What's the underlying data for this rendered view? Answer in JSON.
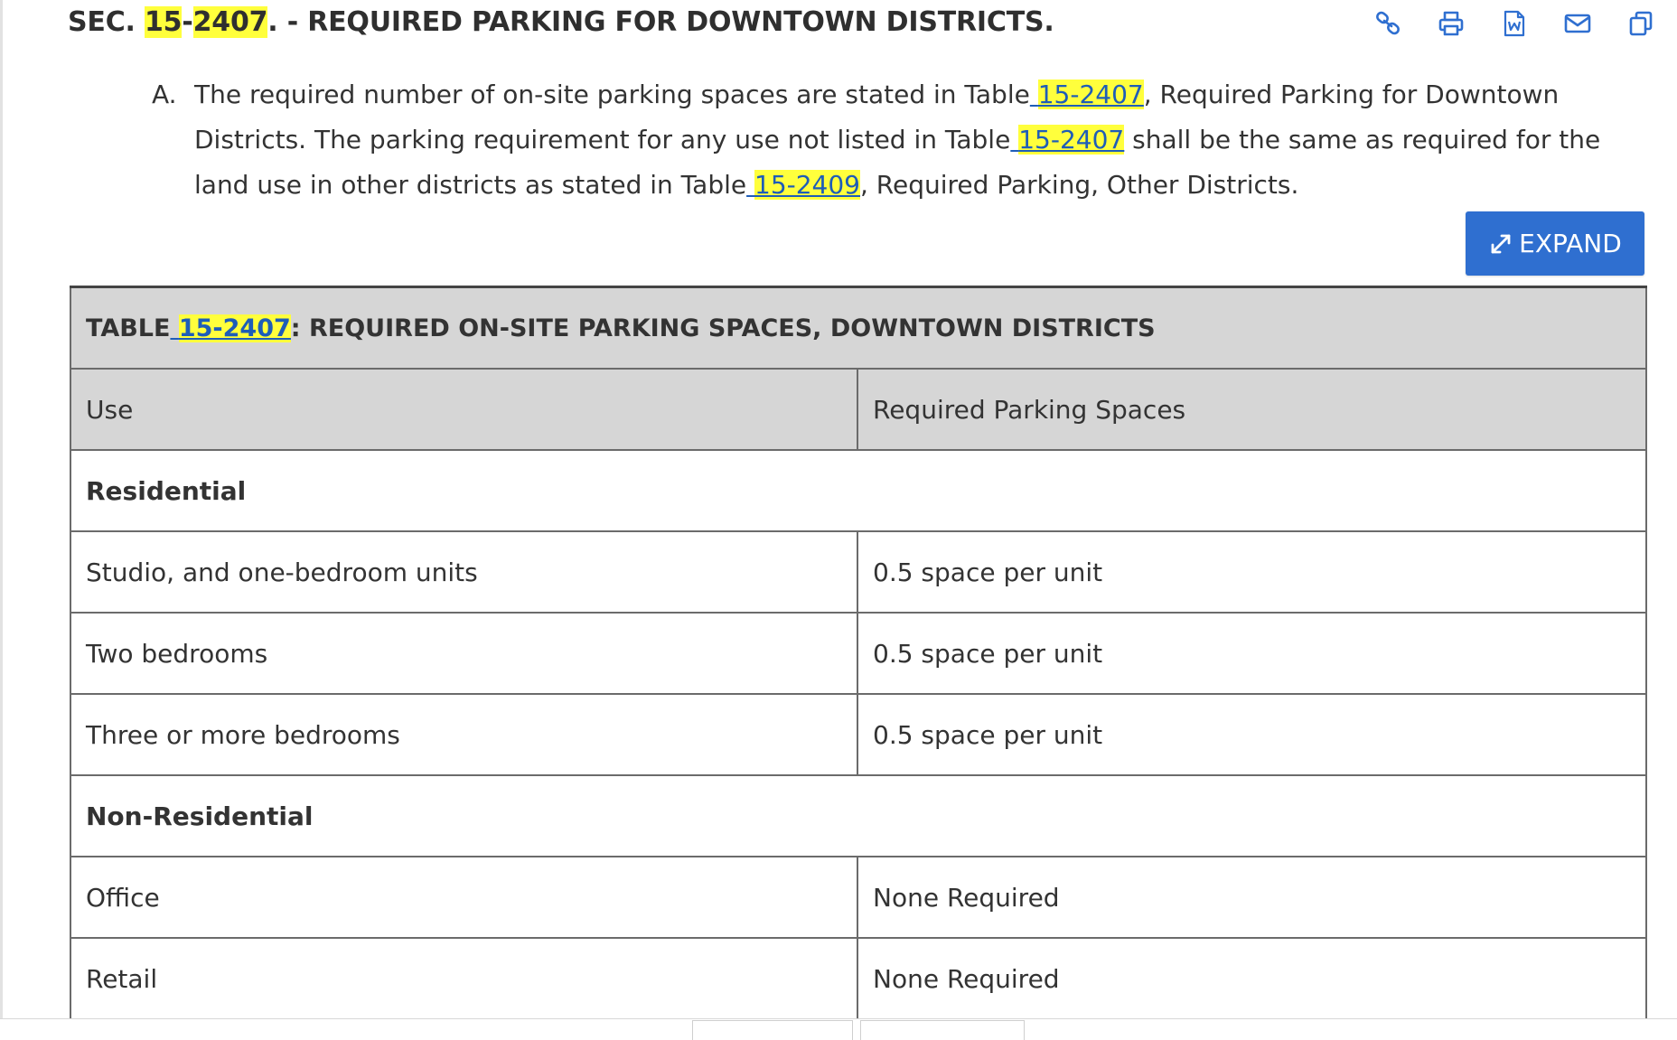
{
  "section": {
    "prefix": "SEC. ",
    "num_a": "15",
    "dash": "-",
    "num_b": "2407",
    "suffix": ". - REQUIRED PARKING FOR DOWNTOWN DISTRICTS."
  },
  "toolbar": {
    "icons": [
      "link-icon",
      "print-icon",
      "word-doc-icon",
      "email-icon",
      "copy-icon"
    ]
  },
  "paragraph": {
    "marker": "A.",
    "t1": "The required number of on-site parking spaces are stated in Table",
    "ref1": "15-2407",
    "t2": ", Required Parking for Downtown Districts. The parking requirement for any use not listed in Table",
    "ref2": "15-2407",
    "t3": " shall be the same as required for the land use in other districts as stated in Table",
    "ref3": "15-2409",
    "t4": ", Required Parking, Other Districts."
  },
  "expand_button": {
    "label": "EXPAND"
  },
  "table": {
    "caption_prefix": "TABLE",
    "caption_ref": "15-2407",
    "caption_suffix": ": REQUIRED ON-SITE PARKING SPACES, DOWNTOWN DISTRICTS",
    "headers": [
      "Use",
      "Required Parking Spaces"
    ],
    "groups": [
      {
        "name": "Residential",
        "rows": [
          [
            "Studio, and one-bedroom units",
            "0.5 space per unit"
          ],
          [
            "Two bedrooms",
            "0.5 space per unit"
          ],
          [
            "Three or more bedrooms",
            "0.5 space per unit"
          ]
        ]
      },
      {
        "name": "Non-Residential",
        "rows": [
          [
            "Office",
            "None Required"
          ],
          [
            "Retail",
            "None Required"
          ]
        ]
      }
    ]
  },
  "colors": {
    "highlight": "#ffff3c",
    "link": "#1e5db8",
    "button": "#2f6fd0",
    "header_bg": "#d6d6d6"
  }
}
